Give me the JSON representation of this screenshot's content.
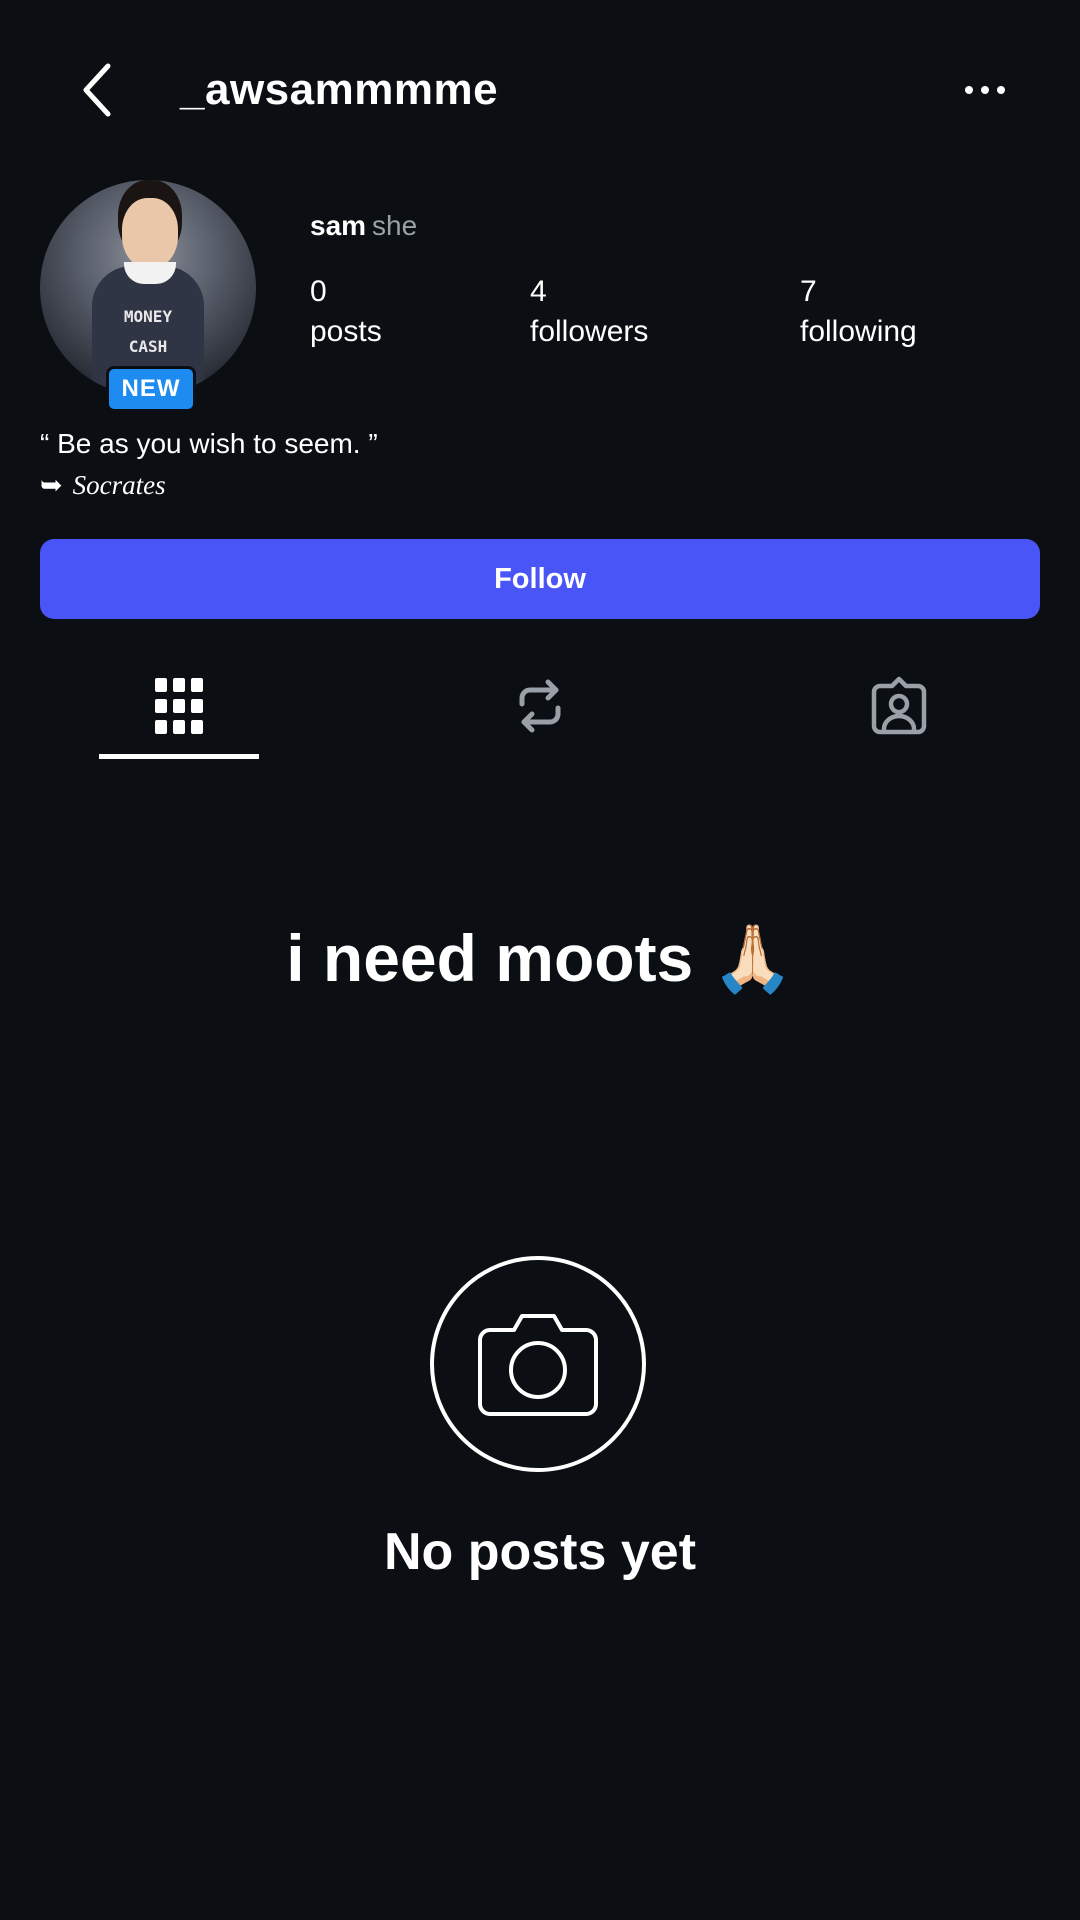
{
  "header": {
    "username": "_awsammmme"
  },
  "profile": {
    "name": "sam",
    "pronoun": "she",
    "badge": "NEW",
    "shirt_text_line1": "MONEY",
    "shirt_text_line2": "CASH",
    "stats": [
      {
        "value": "0",
        "label": "posts"
      },
      {
        "value": "4",
        "label": "followers"
      },
      {
        "value": "7",
        "label": "following"
      }
    ],
    "bio_quote": "“ Be as you wish to seem. ”",
    "bio_arrow": "➥",
    "bio_author": "Socrates"
  },
  "actions": {
    "follow_label": "Follow"
  },
  "tabs": [
    {
      "icon": "grid-icon",
      "selected": true
    },
    {
      "icon": "repost-icon",
      "selected": false
    },
    {
      "icon": "tagged-icon",
      "selected": false
    }
  ],
  "content": {
    "headline": "i need moots 🙏🏻",
    "empty_label": "No posts yet",
    "empty_icon": "camera-icon"
  },
  "colors": {
    "background": "#0b0e12",
    "follow_button": "#4a55f7",
    "new_badge": "#1e8bf0",
    "muted_text": "#9aa0a8"
  }
}
